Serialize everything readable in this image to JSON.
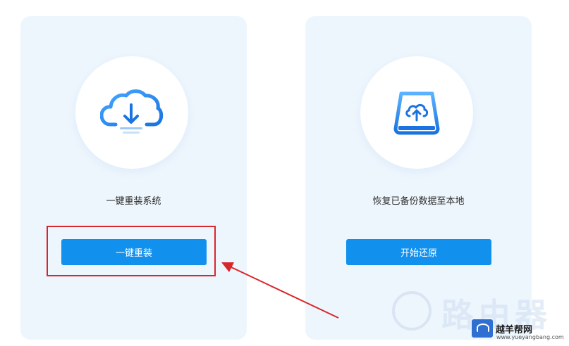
{
  "cards": {
    "reinstall": {
      "icon": "cloud-download-icon",
      "title": "一键重装系统",
      "button_label": "一键重装"
    },
    "restore": {
      "icon": "drive-cloud-upload-icon",
      "title": "恢复已备份数据至本地",
      "button_label": "开始还原"
    }
  },
  "watermark": {
    "big_text": "路由器",
    "badge_text": "越羊帮网",
    "url": "www.yueyangbang.com"
  },
  "colors": {
    "accent": "#1190ee",
    "card_bg": "#eef6fd",
    "highlight": "#d9262b"
  }
}
